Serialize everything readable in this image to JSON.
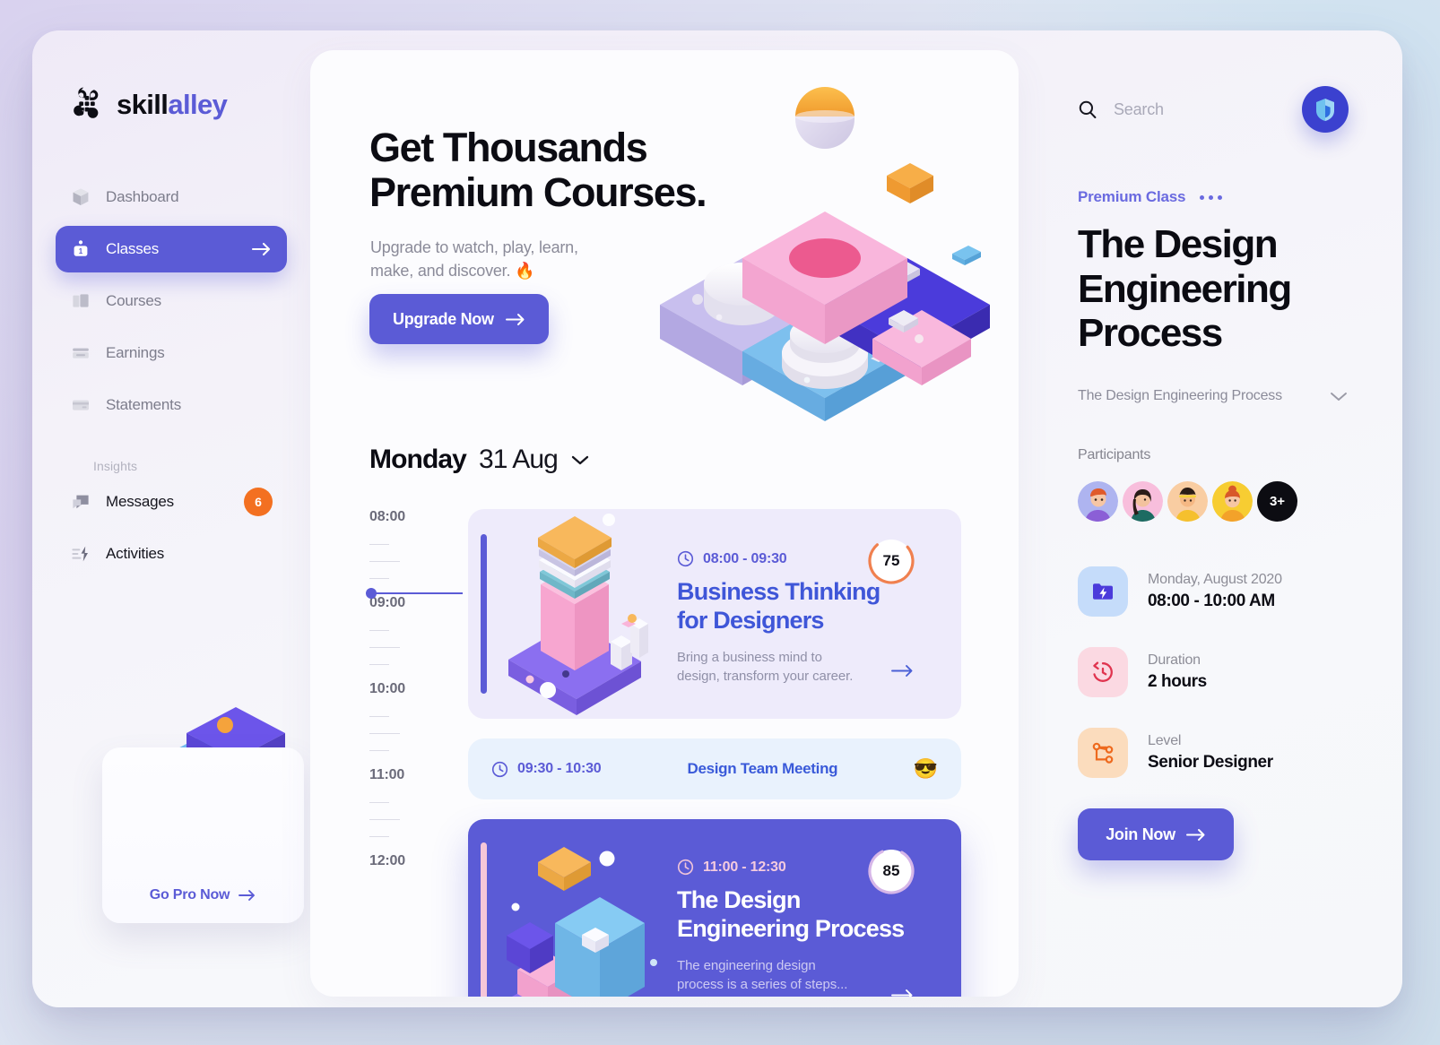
{
  "brand": {
    "part1": "skill",
    "part2": "alley",
    "logo_icon": "flower-logo-icon"
  },
  "sidebar": {
    "items": [
      {
        "label": "Dashboard",
        "icon": "cube-icon",
        "active": false
      },
      {
        "label": "Classes",
        "icon": "person-badge-icon",
        "active": true
      },
      {
        "label": "Courses",
        "icon": "book-icon",
        "active": false
      },
      {
        "label": "Earnings",
        "icon": "money-stack-icon",
        "active": false
      },
      {
        "label": "Statements",
        "icon": "card-icon",
        "active": false
      }
    ],
    "section_label": "Insights",
    "insights": [
      {
        "label": "Messages",
        "icon": "chat-icon",
        "badge": "6"
      },
      {
        "label": "Activities",
        "icon": "activity-bolt-icon",
        "badge": ""
      }
    ],
    "promo": {
      "link_label": "Go Pro Now",
      "arrow_icon": "arrow-right-icon"
    }
  },
  "hero": {
    "title_line1": "Get Thousands",
    "title_line2": "Premium Courses.",
    "subtitle_line1": "Upgrade to watch, play, learn,",
    "subtitle_line2": "make, and discover.  🔥",
    "cta_label": "Upgrade Now",
    "cta_icon": "arrow-right-icon"
  },
  "schedule": {
    "day_name": "Monday",
    "day_date": "31 Aug",
    "day_chevron_icon": "chevron-down-icon",
    "hours": [
      "08:00",
      "09:00",
      "10:00",
      "11:00",
      "12:00"
    ],
    "now_marker": "08:30",
    "cards": [
      {
        "time": "08:00 - 09:30",
        "title_line1": "Business Thinking",
        "title_line2": "for Designers",
        "desc_line1": "Bring a business mind to",
        "desc_line2": "design, transform your career.",
        "score": "75",
        "score_color": "#f0804f",
        "clock_icon": "clock-icon",
        "arrow_icon": "arrow-right-icon"
      },
      {
        "time": "09:30 - 10:30",
        "title": "Design Team Meeting",
        "emoji": "😎",
        "clock_icon": "clock-icon"
      },
      {
        "time": "11:00 - 12:30",
        "title_line1": "The Design",
        "title_line2": "Engineering Process",
        "desc_line1": "The engineering design",
        "desc_line2": "process is a series of steps...",
        "score": "85",
        "score_color": "#d6b6e8",
        "clock_icon": "clock-icon",
        "arrow_icon": "arrow-right-icon"
      }
    ]
  },
  "right": {
    "search": {
      "placeholder": "Search",
      "value": "",
      "icon": "search-icon"
    },
    "avatar_icon": "shield-logo-icon",
    "kicker": "Premium Class",
    "menu_icon": "more-dots-icon",
    "title_line1": "The Design",
    "title_line2": "Engineering",
    "title_line3": "Process",
    "dropdown_value": "The Design Engineering Process",
    "dropdown_icon": "chevron-down-icon",
    "participants_label": "Participants",
    "participants_overflow": "3+",
    "meta": [
      {
        "key": "Monday, August 2020",
        "value": "08:00 - 10:00 AM",
        "icon": "folder-bolt-icon",
        "tone": "blue"
      },
      {
        "key": "Duration",
        "value": "2 hours",
        "icon": "history-clock-icon",
        "tone": "pink"
      },
      {
        "key": "Level",
        "value": "Senior Designer",
        "icon": "skill-tree-icon",
        "tone": "orange"
      }
    ],
    "join_label": "Join Now",
    "join_icon": "arrow-right-icon"
  },
  "colors": {
    "accent": "#5b5bd6",
    "accent_light": "#6a6ae0",
    "badge_orange": "#f37021",
    "card_a_bg": "#eeebfb",
    "card_b_bg": "#e9f2fd",
    "card_c_bg": "#5b5bd6"
  }
}
